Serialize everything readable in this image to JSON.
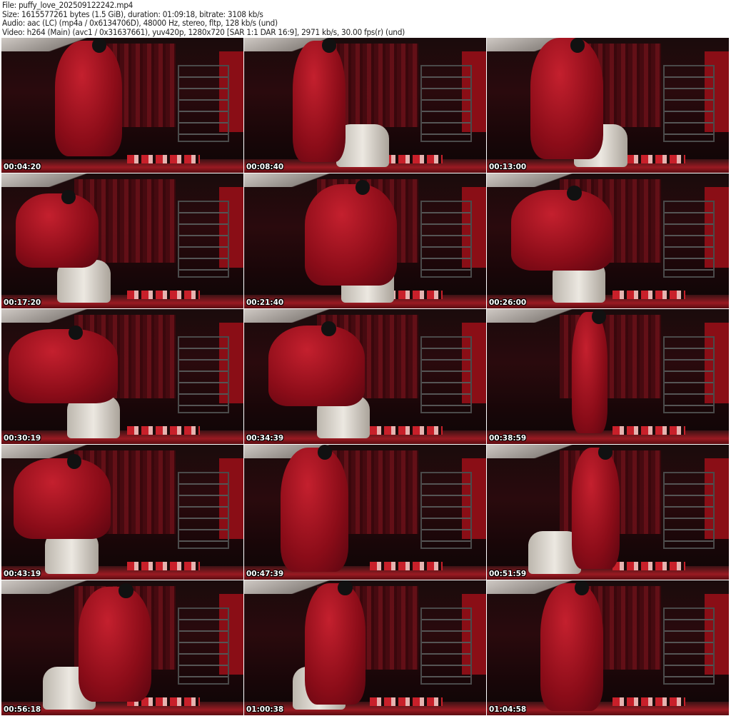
{
  "header": {
    "file": "File: puffy_love_202509122242.mp4",
    "size": "Size: 1615577261 bytes (1.5 GiB), duration: 01:09:18, bitrate: 3108 kb/s",
    "audio": "Audio: aac (LC) (mp4a / 0x6134706D), 48000 Hz, stereo, fltp, 128 kb/s (und)",
    "video": "Video: h264 (Main) (avc1 / 0x31637661), yuv420p, 1280x720 [SAR 1:1 DAR 16:9], 2971 kb/s, 30.00 fps(r) (und)"
  },
  "thumbnails": [
    {
      "timestamp": "00:04:20"
    },
    {
      "timestamp": "00:08:40"
    },
    {
      "timestamp": "00:13:00"
    },
    {
      "timestamp": "00:17:20"
    },
    {
      "timestamp": "00:21:40"
    },
    {
      "timestamp": "00:26:00"
    },
    {
      "timestamp": "00:30:19"
    },
    {
      "timestamp": "00:34:39"
    },
    {
      "timestamp": "00:38:59"
    },
    {
      "timestamp": "00:43:19"
    },
    {
      "timestamp": "00:47:39"
    },
    {
      "timestamp": "00:51:59"
    },
    {
      "timestamp": "00:56:18"
    },
    {
      "timestamp": "01:00:38"
    },
    {
      "timestamp": "01:04:58"
    }
  ]
}
